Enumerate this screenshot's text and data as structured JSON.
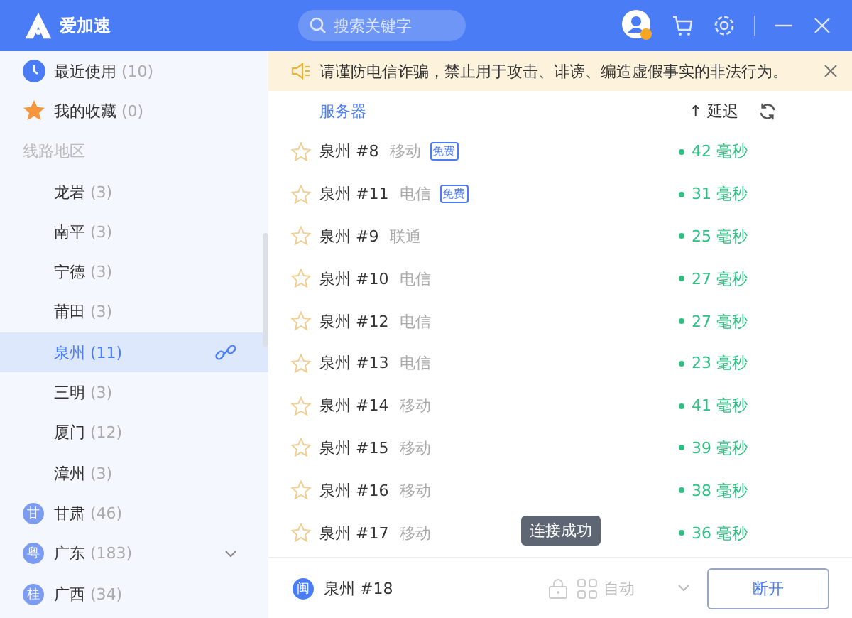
{
  "app": {
    "title": "爱加速"
  },
  "search": {
    "placeholder": "搜索关键字"
  },
  "sidebar": {
    "items": [
      {
        "kind": "recent",
        "label": "最近使用",
        "count": "(10)",
        "selected": false
      },
      {
        "kind": "favorites",
        "label": "我的收藏",
        "count": "(0)",
        "selected": false
      },
      {
        "kind": "section",
        "label": "线路地区"
      },
      {
        "kind": "city",
        "label": "龙岩",
        "count": "(3)",
        "selected": false
      },
      {
        "kind": "city",
        "label": "南平",
        "count": "(3)",
        "selected": false
      },
      {
        "kind": "city",
        "label": "宁德",
        "count": "(3)",
        "selected": false
      },
      {
        "kind": "city",
        "label": "莆田",
        "count": "(3)",
        "selected": false
      },
      {
        "kind": "city",
        "label": "泉州",
        "count": "(11)",
        "selected": true,
        "connected": true
      },
      {
        "kind": "city",
        "label": "三明",
        "count": "(3)",
        "selected": false
      },
      {
        "kind": "city",
        "label": "厦门",
        "count": "(12)",
        "selected": false
      },
      {
        "kind": "city",
        "label": "漳州",
        "count": "(3)",
        "selected": false
      },
      {
        "kind": "province",
        "badge": "甘",
        "label": "甘肃",
        "count": "(46)",
        "selected": false
      },
      {
        "kind": "province",
        "badge": "粤",
        "label": "广东",
        "count": "(183)",
        "selected": false,
        "chevron": true
      },
      {
        "kind": "province",
        "badge": "桂",
        "label": "广西",
        "count": "(34)",
        "selected": false
      }
    ]
  },
  "notice": {
    "text": "请谨防电信诈骗，禁止用于攻击、诽谤、编造虚假事实的非法行为。"
  },
  "table": {
    "columns": [
      "服务器",
      "延迟"
    ],
    "sort_arrow": "↑",
    "rows": [
      {
        "name": "泉州 #8",
        "carrier": "移动",
        "tag": "免费",
        "latency": "42 毫秒",
        "favorite": false
      },
      {
        "name": "泉州 #11",
        "carrier": "电信",
        "tag": "免费",
        "latency": "31 毫秒",
        "favorite": false
      },
      {
        "name": "泉州 #9",
        "carrier": "联通",
        "latency": "25 毫秒",
        "favorite": false
      },
      {
        "name": "泉州 #10",
        "carrier": "电信",
        "latency": "27 毫秒",
        "favorite": false
      },
      {
        "name": "泉州 #12",
        "carrier": "电信",
        "latency": "27 毫秒",
        "favorite": false
      },
      {
        "name": "泉州 #13",
        "carrier": "电信",
        "latency": "23 毫秒",
        "favorite": false
      },
      {
        "name": "泉州 #14",
        "carrier": "移动",
        "latency": "41 毫秒",
        "favorite": false
      },
      {
        "name": "泉州 #15",
        "carrier": "移动",
        "latency": "39 毫秒",
        "favorite": false
      },
      {
        "name": "泉州 #16",
        "carrier": "移动",
        "latency": "38 毫秒",
        "favorite": false
      },
      {
        "name": "泉州 #17",
        "carrier": "移动",
        "latency": "36 毫秒",
        "favorite": false
      }
    ]
  },
  "tooltip": {
    "text": "连接成功"
  },
  "status_bar": {
    "badge": "闽",
    "server": "泉州 #18",
    "mode": "自动",
    "button": "断开"
  }
}
